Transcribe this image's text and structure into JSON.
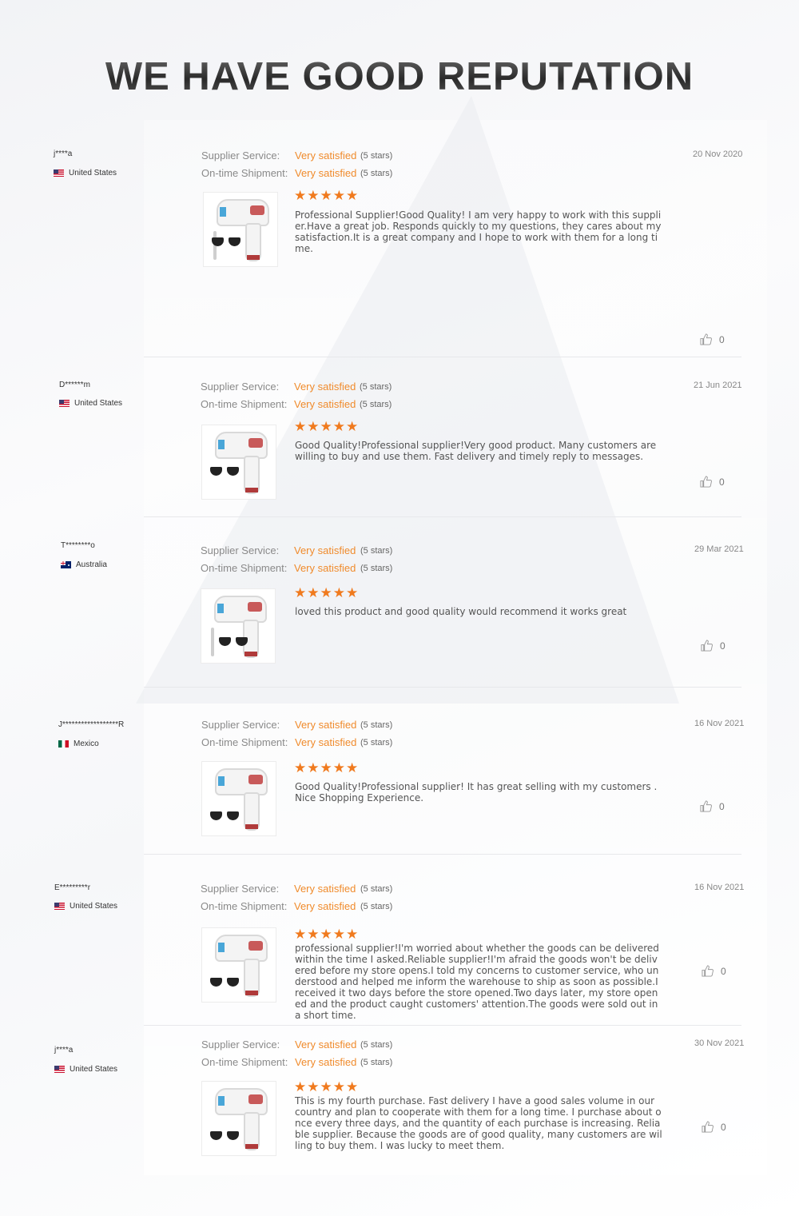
{
  "title": "WE HAVE GOOD REPUTATION",
  "labels": {
    "supplier_service": "Supplier Service:",
    "on_time_shipment": "On-time Shipment:"
  },
  "colors": {
    "rating_value": "#f08b2c",
    "star": "#f07a1e"
  },
  "reviews": [
    {
      "user": "j****a",
      "country": "United States",
      "flag_icon": "us-flag-icon",
      "supplier_rating": "Very satisfied",
      "supplier_stars": "(5 stars)",
      "shipment_rating": "Very satisfied",
      "shipment_stars": "(5 stars)",
      "date": "20 Nov 2020",
      "stars": "★★★★★",
      "comment": "Professional Supplier!Good Quality! I am very happy to work with this supplier.Have a great job. Responds quickly to my questions, they cares about my satisfaction.It is a great company and I hope to work with them for a long time.",
      "likes": "0"
    },
    {
      "user": "D******m",
      "country": "United States",
      "flag_icon": "us-flag-icon",
      "supplier_rating": "Very satisfied",
      "supplier_stars": "(5 stars)",
      "shipment_rating": "Very satisfied",
      "shipment_stars": "(5 stars)",
      "date": "21 Jun 2021",
      "stars": "★★★★★",
      "comment": "Good Quality!Professional supplier!Very good product. Many customers are willing to buy and use them. Fast delivery and timely reply to messages.",
      "likes": "0"
    },
    {
      "user": "T********o",
      "country": "Australia",
      "flag_icon": "au-flag-icon",
      "supplier_rating": "Very satisfied",
      "supplier_stars": "(5 stars)",
      "shipment_rating": "Very satisfied",
      "shipment_stars": "(5 stars)",
      "date": "29 Mar 2021",
      "stars": "★★★★★",
      "comment": "loved this product and good quality would recommend it works great",
      "likes": "0"
    },
    {
      "user": "J******************R",
      "country": "Mexico",
      "flag_icon": "mx-flag-icon",
      "supplier_rating": "Very satisfied",
      "supplier_stars": "(5 stars)",
      "shipment_rating": "Very satisfied",
      "shipment_stars": "(5 stars)",
      "date": "16 Nov 2021",
      "stars": "★★★★★",
      "comment": "Good Quality!Professional supplier! It has great selling with my customers . Nice Shopping Experience.",
      "likes": "0"
    },
    {
      "user": "E*********r",
      "country": "United States",
      "flag_icon": "us-flag-icon",
      "supplier_rating": "Very satisfied",
      "supplier_stars": "(5 stars)",
      "shipment_rating": "Very satisfied",
      "shipment_stars": "(5 stars)",
      "date": "16 Nov 2021",
      "stars": "★★★★★",
      "comment": "professional supplier!I'm worried about whether the goods can be delivered within the time I asked.Reliable supplier!I'm afraid the goods won't be delivered before my store opens.I told my concerns to customer service, who understood and helped me inform the warehouse to ship as soon as possible.I received it two days before the store opened.Two days later, my store opened and the product caught customers' attention.The goods were sold out in a short time.",
      "likes": "0"
    },
    {
      "user": "j****a",
      "country": "United States",
      "flag_icon": "us-flag-icon",
      "supplier_rating": "Very satisfied",
      "supplier_stars": "(5 stars)",
      "shipment_rating": "Very satisfied",
      "shipment_stars": "(5 stars)",
      "date": "30 Nov 2021",
      "stars": "★★★★★",
      "comment": "This is my fourth purchase. Fast delivery I have a good sales volume in our country and plan to cooperate with them for a long time. I purchase about once every three days, and the quantity of each purchase is increasing. Reliable supplier. Because the goods are of good quality, many customers are willing to buy them. I was lucky to meet them.",
      "likes": "0"
    }
  ]
}
